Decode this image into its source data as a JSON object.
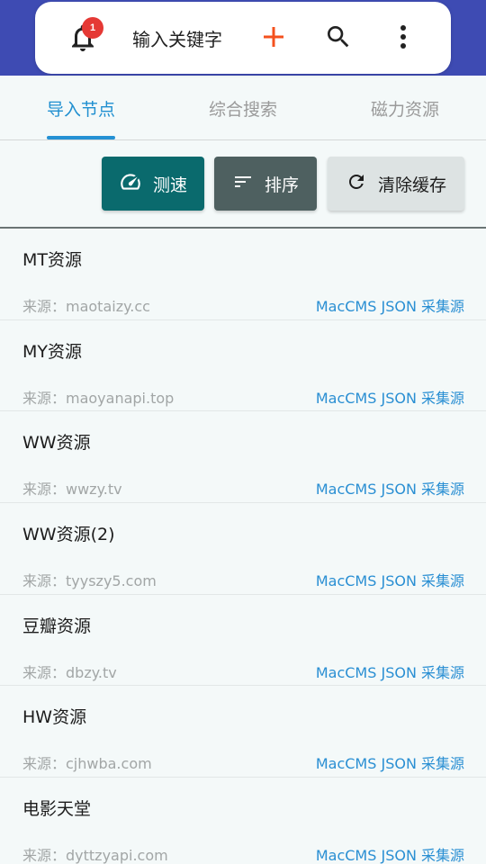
{
  "header": {
    "notification_count": "1",
    "search_text": "输入关键字",
    "icons": {
      "notification": "bell-icon",
      "add": "plus-icon",
      "search": "search-icon",
      "more": "more-vert-icon"
    },
    "colors": {
      "header_bg": "#3e4bb3",
      "add_icon": "#f4511e",
      "badge": "#e53935"
    }
  },
  "tabs": [
    {
      "label": "导入节点",
      "active": true
    },
    {
      "label": "综合搜索",
      "active": false
    },
    {
      "label": "磁力资源",
      "active": false
    }
  ],
  "toolbar": {
    "speed_label": "测速",
    "sort_label": "排序",
    "clear_label": "清除缓存",
    "icons": {
      "speed": "speedometer-icon",
      "sort": "sort-icon",
      "clear": "refresh-icon"
    }
  },
  "sources": [
    {
      "name": "MT资源",
      "source": "来源：maotaizy.cc",
      "type": "MacCMS JSON 采集源"
    },
    {
      "name": "MY资源",
      "source": "来源：maoyanapi.top",
      "type": "MacCMS JSON 采集源"
    },
    {
      "name": "WW资源",
      "source": "来源：wwzy.tv",
      "type": "MacCMS JSON 采集源"
    },
    {
      "name": "WW资源(2)",
      "source": "来源：tyyszy5.com",
      "type": "MacCMS JSON 采集源"
    },
    {
      "name": "豆瓣资源",
      "source": "来源：dbzy.tv",
      "type": "MacCMS JSON 采集源"
    },
    {
      "name": "HW资源",
      "source": "来源：cjhwba.com",
      "type": "MacCMS JSON 采集源"
    },
    {
      "name": "电影天堂",
      "source": "来源：dyttzyapi.com",
      "type": "MacCMS JSON 采集源"
    }
  ]
}
